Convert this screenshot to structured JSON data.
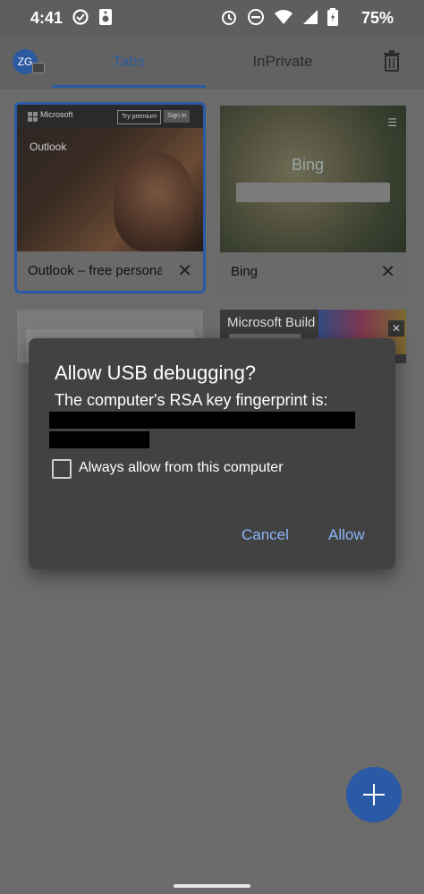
{
  "status_bar": {
    "time": "4:41",
    "battery": "75%"
  },
  "app_bar": {
    "avatar_initials": "ZG",
    "tabs_label": "Tabs",
    "inprivate_label": "InPrivate"
  },
  "tabs": [
    {
      "title": "Outlook – free personal",
      "thumbnail": {
        "brand": "Microsoft",
        "btn_try": "Try premium",
        "btn_signin": "Sign in",
        "heading": "Outlook"
      }
    },
    {
      "title": "Bing",
      "thumbnail": {
        "brand": "Bing"
      }
    },
    {
      "title": "",
      "thumbnail": {}
    },
    {
      "title": "",
      "thumbnail": {
        "heading": "Microsoft Build"
      }
    }
  ],
  "dialog": {
    "title": "Allow USB debugging?",
    "message": "The computer's RSA key fingerprint is:",
    "checkbox_label": "Always allow from this computer",
    "cancel": "Cancel",
    "allow": "Allow"
  },
  "colors": {
    "accent": "#2a5aa5",
    "dialog_button": "#8ab4f8",
    "dialog_bg": "#424242"
  }
}
